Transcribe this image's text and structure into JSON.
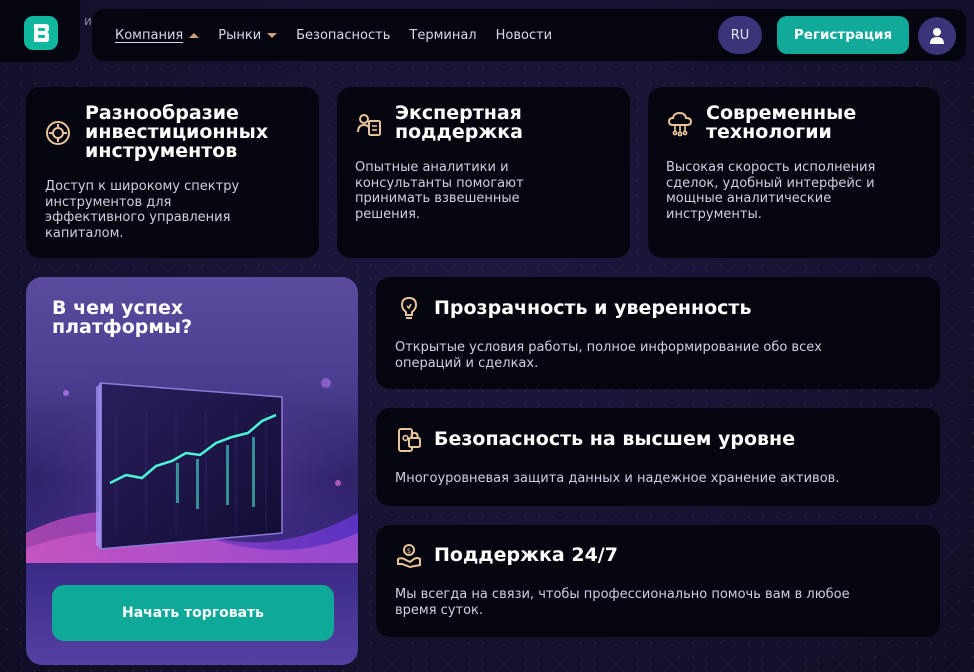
{
  "header": {
    "logo_trunc": "иб",
    "nav": [
      {
        "label": "Компания",
        "caret": "up"
      },
      {
        "label": "Рынки",
        "caret": "down"
      },
      {
        "label": "Безопасность"
      },
      {
        "label": "Терминал"
      },
      {
        "label": "Новости"
      }
    ],
    "lang": "RU",
    "register": "Регистрация"
  },
  "features": [
    {
      "title": "Разнообразие\nинвестиционных\nинструментов",
      "text": "Доступ к широкому спектру\nинструментов для\nэффективного управления\nкапиталом.",
      "icon": "coin-gear-icon"
    },
    {
      "title": "Экспертная\nподдержка",
      "text": "Опытные аналитики и\nконсультанты помогают\nпринимать взвешенные\nрешения.",
      "icon": "expert-icon"
    },
    {
      "title": "Современные\nтехнологии",
      "text": "Высокая скорость исполнения\nсделок, удобный интерфейс и\nмощные аналитические\nинструменты.",
      "icon": "cloud-tech-icon"
    }
  ],
  "promo": {
    "title": "В чем успех\nплатформы?",
    "button": "Начать торговать"
  },
  "benefits": [
    {
      "title": "Прозрачность и уверенность",
      "text": "Открытые условия работы, полное информирование обо всех\nопераций и сделках.",
      "icon": "lightbulb-icon"
    },
    {
      "title": "Безопасность на высшем уровне",
      "text": "Многоуровневая защита данных и надежное хранение активов.",
      "icon": "secure-phone-icon"
    },
    {
      "title": "Поддержка 24/7",
      "text": "Мы всегда на связи, чтобы профессионально помочь вам в любое\nвремя суток.",
      "icon": "support-hands-icon"
    }
  ],
  "colors": {
    "accent": "#11a99a",
    "icon": "#e8c49a",
    "card_bg": "#050510",
    "page_bg": "#15122f"
  }
}
